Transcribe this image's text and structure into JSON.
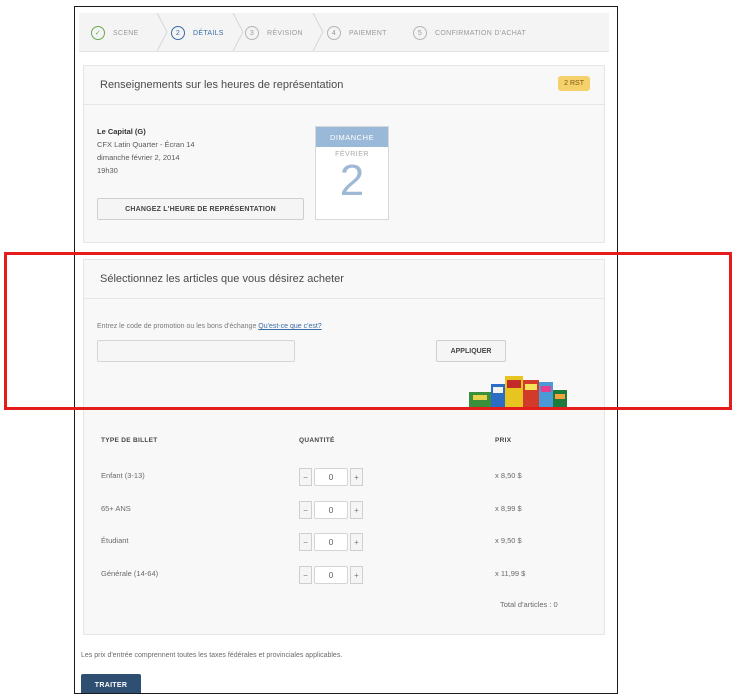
{
  "steps": [
    {
      "num": "✓",
      "label": "SCENE",
      "state": "done"
    },
    {
      "num": "2",
      "label": "DÉTAILS",
      "state": "active"
    },
    {
      "num": "3",
      "label": "RÉVISION",
      "state": "todo"
    },
    {
      "num": "4",
      "label": "PAIEMENT",
      "state": "todo"
    },
    {
      "num": "5",
      "label": "CONFIRMATION D'ACHAT",
      "state": "todo"
    }
  ],
  "showtime": {
    "title": "Renseignements sur les heures de représentation",
    "badge": "2 RST",
    "venue_name": "Le Capital (G)",
    "venue_line1": "CFX Latin Quarter - Écran 14",
    "date": "dimanche février 2, 2014",
    "time": "19h30",
    "change_button": "CHANGEZ L'HEURE DE REPRÉSENTATION",
    "calendar": {
      "weekday": "DIMANCHE",
      "month": "FÉVRIER",
      "day": "2"
    }
  },
  "purchase": {
    "title": "Sélectionnez les articles que vous désirez acheter",
    "promo_text": "Entrez le code de promotion ou les bons d'échange",
    "promo_link": "Qu'est-ce que c'est?",
    "promo_placeholder": "",
    "apply_button": "APPLIQUER",
    "headers": {
      "type": "TYPE DE BILLET",
      "qty": "QUANTITÉ",
      "price": "PRIX"
    },
    "tickets": [
      {
        "label": "Enfant (3-13)",
        "qty": "0",
        "price": "x 8,50 $"
      },
      {
        "label": "65+ ANS",
        "qty": "0",
        "price": "x 8,99 $"
      },
      {
        "label": "Étudiant",
        "qty": "0",
        "price": "x 9,50 $"
      },
      {
        "label": "Générale (14-64)",
        "qty": "0",
        "price": "x 11,99 $"
      }
    ],
    "total": "Total d'articles : 0"
  },
  "footer": {
    "note": "Les prix d'entrée comprennent toutes les taxes fédérales et provinciales applicables.",
    "submit": "TRAITER"
  },
  "colors": {
    "accent": "#3b6ea5",
    "highlight_box": "#e51c1c",
    "submit_bg": "#2e4f72",
    "badge_bg": "#f6d06a"
  }
}
